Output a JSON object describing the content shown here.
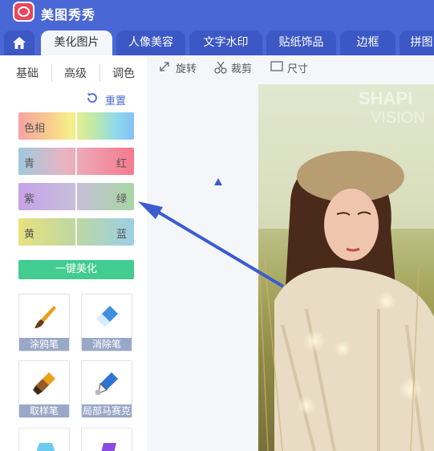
{
  "app": {
    "title": "美图秀秀"
  },
  "nav": {
    "tabs": [
      {
        "label": "美化图片",
        "active": true
      },
      {
        "label": "人像美容"
      },
      {
        "label": "文字水印"
      },
      {
        "label": "贴纸饰品"
      },
      {
        "label": "边框"
      },
      {
        "label": "拼图"
      }
    ]
  },
  "sidebar": {
    "subtabs": [
      {
        "label": "基础"
      },
      {
        "label": "高级"
      },
      {
        "label": "调色",
        "active": true
      }
    ],
    "reset_label": "重置",
    "sliders": [
      {
        "left": "色相",
        "right": ""
      },
      {
        "left": "青",
        "right": "红"
      },
      {
        "left": "紫",
        "right": "绿"
      },
      {
        "left": "黄",
        "right": "蓝"
      }
    ],
    "one_click_label": "一键美化",
    "tools": [
      {
        "label": "涂鸦笔",
        "icon": "brush-icon"
      },
      {
        "label": "消除笔",
        "icon": "eraser-icon"
      },
      {
        "label": "取样笔",
        "icon": "sample-brush-icon"
      },
      {
        "label": "局部马赛克",
        "icon": "mosaic-pen-icon"
      }
    ]
  },
  "toolbar": {
    "rotate_label": "旋转",
    "crop_label": "裁剪",
    "size_label": "尺寸"
  },
  "photo": {
    "watermark_line1": "SHAPI",
    "watermark_line2": "VISION"
  },
  "colors": {
    "brand_blue": "#4a67d6",
    "tab_blue": "#3c58c4",
    "green_button": "#42cc8f",
    "arrow": "#3b5ccf"
  }
}
